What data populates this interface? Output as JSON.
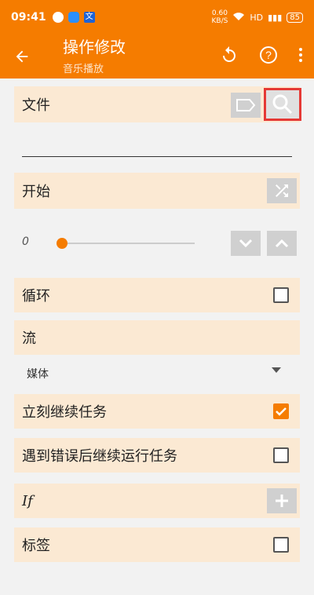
{
  "status": {
    "time": "09:41",
    "speed": "0.60\nKB/S",
    "network": "HD",
    "battery": "85"
  },
  "header": {
    "title": "操作修改",
    "subtitle": "音乐播放"
  },
  "rows": {
    "file": {
      "label": "文件"
    },
    "start": {
      "label": "开始"
    },
    "slider": {
      "value": "0"
    },
    "loop": {
      "label": "循环"
    },
    "stream": {
      "label": "流"
    },
    "media": {
      "label": "媒体"
    },
    "continue": {
      "label": "立刻继续任务"
    },
    "continue_after_error": {
      "label": "遇到错误后继续运行任务"
    },
    "if": {
      "label": "If"
    },
    "tag": {
      "label": "标签"
    }
  }
}
